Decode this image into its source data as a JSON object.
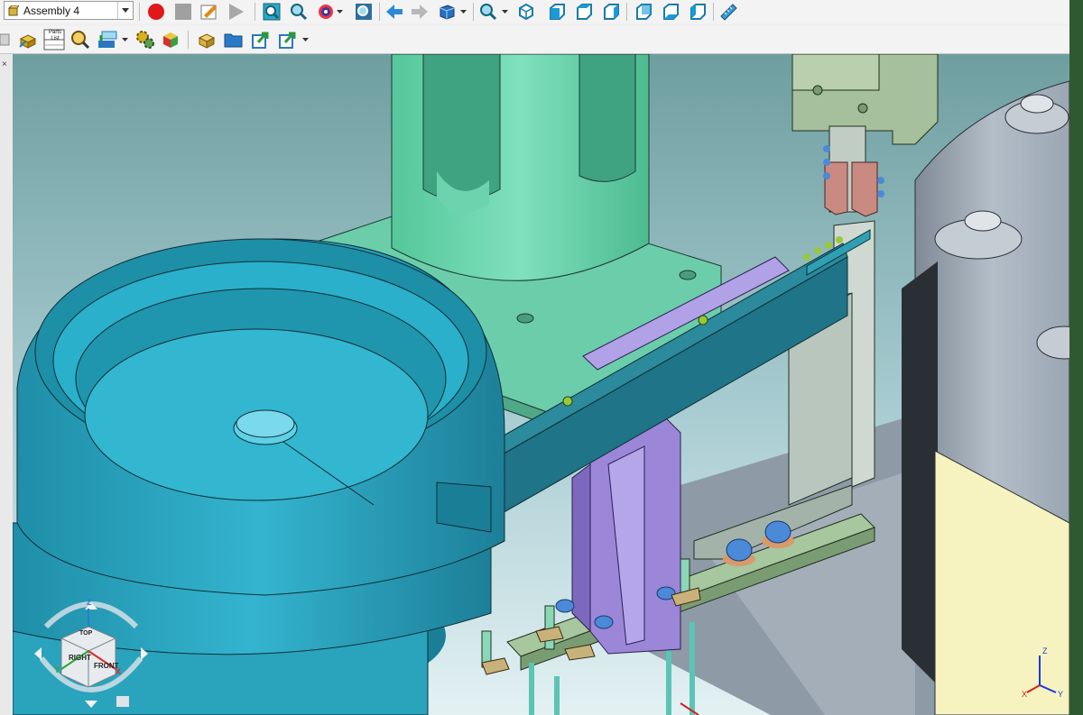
{
  "toolbar_top": {
    "assembly_selector": {
      "value": "Assembly 4",
      "icon": "assembly-icon"
    },
    "buttons": [
      {
        "name": "record-macro-button",
        "icon": "record-icon",
        "color": "#e02020"
      },
      {
        "name": "stop-macro-button",
        "icon": "stop-icon"
      },
      {
        "name": "edit-macro-button",
        "icon": "edit-icon"
      },
      {
        "name": "play-macro-button",
        "icon": "play-icon"
      },
      {
        "name": "zoom-window-button",
        "icon": "zoom-window-icon"
      },
      {
        "name": "zoom-dynamic-button",
        "icon": "zoom-icon"
      },
      {
        "name": "orbit-button",
        "icon": "orbit-icon"
      },
      {
        "name": "fit-view-button",
        "icon": "fit-view-icon"
      },
      {
        "name": "previous-view-button",
        "icon": "arrow-left-icon"
      },
      {
        "name": "next-view-button",
        "icon": "arrow-right-icon"
      },
      {
        "name": "standard-views-button",
        "icon": "cube-views-icon"
      },
      {
        "name": "zoom-options-button",
        "icon": "zoom-icon"
      },
      {
        "name": "view-isometric-button",
        "icon": "iso-cube-icon"
      },
      {
        "name": "view-front-button",
        "icon": "front-cube-icon"
      },
      {
        "name": "view-top-button",
        "icon": "top-cube-icon"
      },
      {
        "name": "view-right-button",
        "icon": "right-cube-icon"
      },
      {
        "name": "view-back-button",
        "icon": "back-cube-icon"
      },
      {
        "name": "view-bottom-button",
        "icon": "bottom-cube-icon"
      },
      {
        "name": "view-left-button",
        "icon": "left-cube-icon"
      },
      {
        "name": "measure-button",
        "icon": "ruler-icon"
      }
    ]
  },
  "toolbar_second": {
    "buttons": [
      {
        "name": "component-properties-button",
        "icon": "component-icon"
      },
      {
        "name": "parts-list-button",
        "icon": "parts-list-icon",
        "label_line1": "Parts",
        "label_line2": "List"
      },
      {
        "name": "inspect-button",
        "icon": "magnifier-icon"
      },
      {
        "name": "insert-component-button",
        "icon": "insert-icon"
      },
      {
        "name": "gears-button",
        "icon": "gears-icon"
      },
      {
        "name": "color-cube-button",
        "icon": "color-cube-icon"
      },
      {
        "name": "new-part-button",
        "icon": "new-part-icon"
      },
      {
        "name": "open-folder-button",
        "icon": "folder-icon"
      },
      {
        "name": "export-button",
        "icon": "export-icon"
      },
      {
        "name": "export-options-button",
        "icon": "export-icon"
      }
    ]
  },
  "navigation_cube": {
    "faces": [
      "RIGHT",
      "FRONT",
      "TOP"
    ],
    "axes": [
      "Z",
      "X",
      "Y"
    ]
  },
  "corner_axes": [
    "Z",
    "X",
    "Y"
  ],
  "colors": {
    "bowl": "#2aa3bd",
    "bracket": "#9b86d8",
    "base_plate": "#69c9a8",
    "green_plate": "#7aa98a",
    "gripper": "#a0b898",
    "machine": "#9aa6b3",
    "cream_panel": "#f6f3c0",
    "sky_top": "#6a9a9c",
    "sky_bottom": "#d9ecef"
  }
}
